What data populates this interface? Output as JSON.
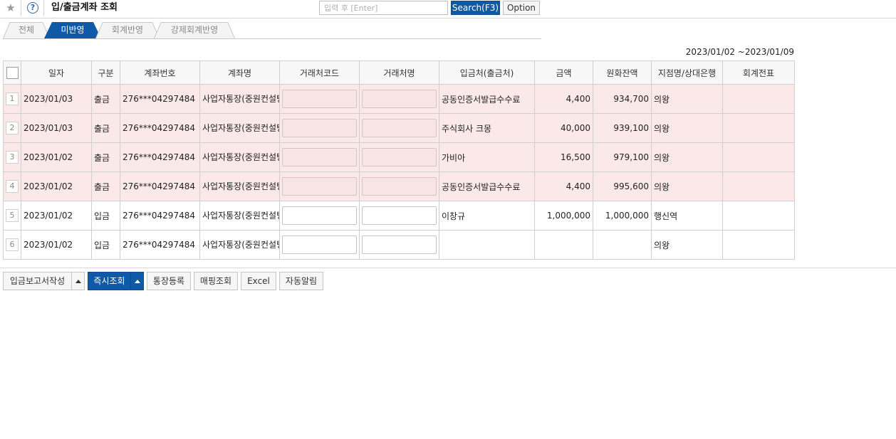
{
  "header": {
    "title": "입/출금계좌 조회",
    "search_placeholder": "입력 후 [Enter]",
    "search_button": "Search(F3)",
    "option_button": "Option"
  },
  "tabs": [
    {
      "label": "전체",
      "active": false
    },
    {
      "label": "미반영",
      "active": true
    },
    {
      "label": "회계반영",
      "active": false
    },
    {
      "label": "강제회계반영",
      "active": false
    }
  ],
  "date_range": "2023/01/02 ~2023/01/09",
  "table": {
    "headers": [
      "일자",
      "구분",
      "계좌번호",
      "계좌명",
      "거래처코드",
      "거래처명",
      "입금처(출금처)",
      "금액",
      "원화잔액",
      "지점명/상대은행",
      "회계전표"
    ],
    "rows": [
      {
        "no": "1",
        "date": "2023/01/03",
        "type": "출금",
        "account_no": "276***04297484",
        "account_name": "사업자통장(중원컨설팅)",
        "counterparty": "공동인증서발급수수료",
        "amount": "4,400",
        "balance": "934,700",
        "branch": "의왕",
        "voucher": "",
        "highlight": true
      },
      {
        "no": "2",
        "date": "2023/01/03",
        "type": "출금",
        "account_no": "276***04297484",
        "account_name": "사업자통장(중원컨설팅)",
        "counterparty": "주식회사 크몽",
        "amount": "40,000",
        "balance": "939,100",
        "branch": "의왕",
        "voucher": "",
        "highlight": true
      },
      {
        "no": "3",
        "date": "2023/01/02",
        "type": "출금",
        "account_no": "276***04297484",
        "account_name": "사업자통장(중원컨설팅)",
        "counterparty": "가비아",
        "amount": "16,500",
        "balance": "979,100",
        "branch": "의왕",
        "voucher": "",
        "highlight": true
      },
      {
        "no": "4",
        "date": "2023/01/02",
        "type": "출금",
        "account_no": "276***04297484",
        "account_name": "사업자통장(중원컨설팅)",
        "counterparty": "공동인증서발급수수료",
        "amount": "4,400",
        "balance": "995,600",
        "branch": "의왕",
        "voucher": "",
        "highlight": true
      },
      {
        "no": "5",
        "date": "2023/01/02",
        "type": "입금",
        "account_no": "276***04297484",
        "account_name": "사업자통장(중원컨설팅)",
        "counterparty": "이창규",
        "amount": "1,000,000",
        "balance": "1,000,000",
        "branch": "행신역",
        "voucher": "",
        "highlight": false
      },
      {
        "no": "6",
        "date": "2023/01/02",
        "type": "입금",
        "account_no": "276***04297484",
        "account_name": "사업자통장(중원컨설팅)",
        "counterparty": "",
        "amount": "",
        "balance": "",
        "branch": "의왕",
        "voucher": "",
        "highlight": false
      }
    ]
  },
  "bottom_buttons": {
    "deposit_report": "입금보고서작성",
    "instant_query": "즉시조회",
    "register_account": "통장등록",
    "mapping_query": "매핑조회",
    "excel": "Excel",
    "auto_alert": "자동알림"
  },
  "colors": {
    "primary_blue": "#0e5aa7",
    "row_highlight": "#fbe9ea"
  },
  "icons": {
    "favorite": "star-icon",
    "help": "help-icon",
    "dropdown": "caret-up-icon"
  }
}
